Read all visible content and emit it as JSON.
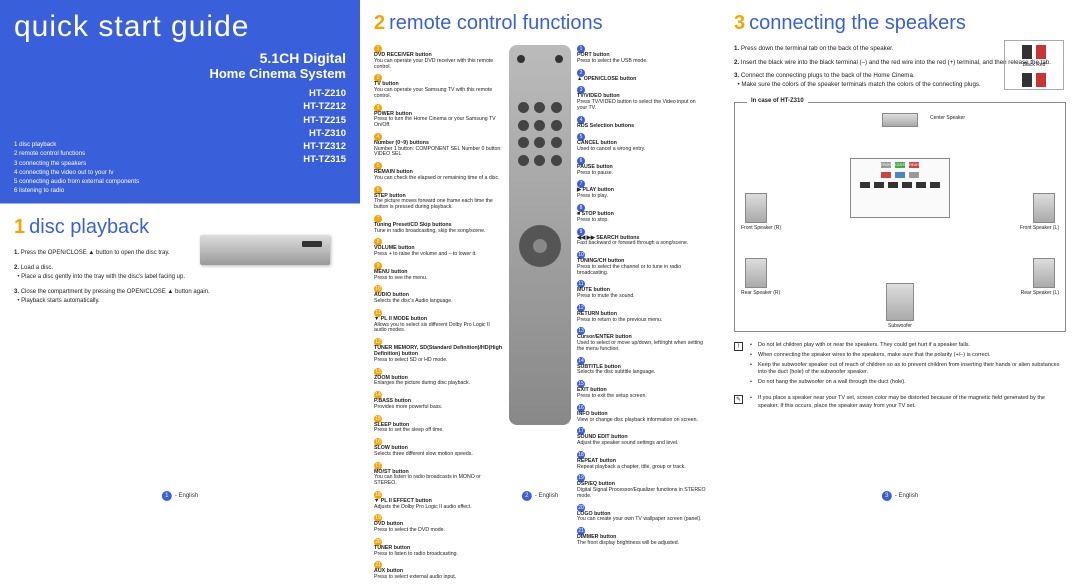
{
  "cover": {
    "title": "quick start guide",
    "product_line1": "5.1CH Digital",
    "product_line2": "Home Cinema System",
    "models": [
      "HT-Z210",
      "HT-TZ212",
      "HT-TZ215",
      "HT-Z310",
      "HT-TZ312",
      "HT-TZ315"
    ],
    "toc": [
      "1 disc playback",
      "2 remote control functions",
      "3 connecting the speakers",
      "4 connecting the video out to your tv",
      "5 connecting audio from external components",
      "6 listening to radio"
    ]
  },
  "section1": {
    "num": "1",
    "title": "disc playback",
    "steps": [
      {
        "n": "1.",
        "text": "Press the OPEN/CLOSE ▲ button to open the disc tray.",
        "bold": "OPEN/CLOSE"
      },
      {
        "n": "2.",
        "text": "Load a disc.",
        "sub": "Place a disc gently into the tray with the disc's label facing up."
      },
      {
        "n": "3.",
        "text": "Close the compartment by pressing the OPEN/CLOSE ▲ button again.",
        "bold": "OPEN/CLOSE",
        "sub": "Playback starts automatically."
      }
    ]
  },
  "section2": {
    "num": "2",
    "title": "remote control functions",
    "left": [
      {
        "t": "DVD RECEIVER button",
        "d": "You can operate your DVD receiver with this remote control."
      },
      {
        "t": "TV button",
        "d": "You can operate your Samsung TV with this remote control."
      },
      {
        "t": "POWER button",
        "d": "Press to turn the Home Cinema or your Samsung TV On/Off."
      },
      {
        "t": "Number (0~9) buttons",
        "d": "Number 1 button: COMPONENT SEL Number 0 button: VIDEO SEL"
      },
      {
        "t": "REMAIN button",
        "d": "You can check the elapsed or remaining time of a disc."
      },
      {
        "t": "STEP button",
        "d": "The picture moves forward one frame each time the button is pressed during playback."
      },
      {
        "t": "Tuning Preset/CD Skip buttons",
        "d": "Tune in radio broadcasting, skip the song/scene."
      },
      {
        "t": "VOLUME button",
        "d": "Press + to raise the volume and – to lower it."
      },
      {
        "t": "MENU button",
        "d": "Press to see the menu."
      },
      {
        "t": "AUDIO button",
        "d": "Selects the disc's Audio language."
      },
      {
        "t": "▼ PL II MODE button",
        "d": "Allows you to select six different Dolby Pro Logic II audio modes."
      },
      {
        "t": "TUNER MEMORY, SD(Standard Definition)/HD(High Definition) button",
        "d": "Press to select SD or HD mode."
      },
      {
        "t": "ZOOM button",
        "d": "Enlarges the picture during disc playback."
      },
      {
        "t": "P.BASS button",
        "d": "Provides more powerful bass."
      },
      {
        "t": "SLEEP button",
        "d": "Press to set the sleep off time."
      },
      {
        "t": "SLOW button",
        "d": "Selects three different slow motion speeds."
      },
      {
        "t": "MO/ST button",
        "d": "You can listen to radio broadcasts in MONO or STEREO."
      },
      {
        "t": "▼ PL II EFFECT button",
        "d": "Adjusts the Dolby Pro Logic II audio effect."
      },
      {
        "t": "DVD button",
        "d": "Press to select the DVD mode."
      },
      {
        "t": "TUNER button",
        "d": "Press to listen to radio broadcasting."
      },
      {
        "t": "AUX button",
        "d": "Press to select external audio input."
      }
    ],
    "right": [
      {
        "t": "PORT button",
        "d": "Press to select the USB mode."
      },
      {
        "t": "▲ OPEN/CLOSE button",
        "d": ""
      },
      {
        "t": "TV/VIDEO button",
        "d": "Press TV/VIDEO button to select the Video input on your TV."
      },
      {
        "t": "RDS Selection buttons",
        "d": ""
      },
      {
        "t": "CANCEL button",
        "d": "Used to cancel a wrong entry."
      },
      {
        "t": "PAUSE button",
        "d": "Press to pause."
      },
      {
        "t": "▶ PLAY button",
        "d": "Press to play."
      },
      {
        "t": "■ STOP button",
        "d": "Press to stop."
      },
      {
        "t": "◀◀ ▶▶ SEARCH buttons",
        "d": "Fast backward or forward through a song/scene."
      },
      {
        "t": "TUNING/CH button",
        "d": "Press to select the channel or to tune in radio broadcasting."
      },
      {
        "t": "MUTE button",
        "d": "Press to mute the sound."
      },
      {
        "t": "RETURN button",
        "d": "Press to return to the previous menu."
      },
      {
        "t": "Cursor/ENTER button",
        "d": "Used to select or move up/down, left/right when setting the menu function."
      },
      {
        "t": "SUBTITLE button",
        "d": "Selects the disc subtitle language."
      },
      {
        "t": "EXIT button",
        "d": "Press to exit the setup screen."
      },
      {
        "t": "INFO button",
        "d": "View or change disc playback information on screen."
      },
      {
        "t": "SOUND EDIT button",
        "d": "Adjust the speaker sound settings and level."
      },
      {
        "t": "REPEAT button",
        "d": "Repeat playback a chapter, title, group or track."
      },
      {
        "t": "DSP/EQ button",
        "d": "Digital Signal Processor/Equalizer functions in STEREO mode."
      },
      {
        "t": "LOGO button",
        "d": "You can create your own TV wallpaper screen (panel)."
      },
      {
        "t": "DIMMER button",
        "d": "The front display brightness will be adjusted."
      }
    ]
  },
  "section3": {
    "num": "3",
    "title": "connecting the speakers",
    "steps": [
      {
        "n": "1.",
        "t": "Press down the terminal tab on the back of the speaker."
      },
      {
        "n": "2.",
        "t": "Insert the black wire into the black terminal (–) and the red wire into the red (+) terminal, and then release the tab."
      },
      {
        "n": "3.",
        "t": "Connect the connecting plugs to the back of the Home Cinema.",
        "sub": "Make sure the colors of the speaker terminals match the colors of the connecting plugs."
      }
    ],
    "terminal": {
      "black": "Black",
      "red": "Red"
    },
    "box_label": "In case of HT-Z310",
    "speakers": {
      "center": "Center Speaker",
      "fr": "Front Speaker (R)",
      "fl": "Front Speaker (L)",
      "rr": "Rear Speaker (R)",
      "rl": "Rear Speaker (L)",
      "sub": "Subwoofer"
    },
    "notes_warn": [
      "Do not let children play with or near the speakers. They could get hurt if a speaker falls.",
      "When connecting the speaker wires to the speakers, make sure that the polarity (+/–) is correct.",
      "Keep the subwoofer speaker out of reach of children so as to prevent children from inserting their hands or alien substances into the duct (hole) of the subwoofer speaker.",
      "Do not hang the subwoofer on a wall through the duct (hole)."
    ],
    "notes_info": "If you place a speaker near your TV set, screen color may be distorted because of the magnetic field generated by the speaker. If this occurs, place the speaker away from your TV set."
  },
  "footers": {
    "p1": "- English",
    "p2": "- English",
    "p3": "- English",
    "n1": "1",
    "n2": "2",
    "n3": "3"
  }
}
